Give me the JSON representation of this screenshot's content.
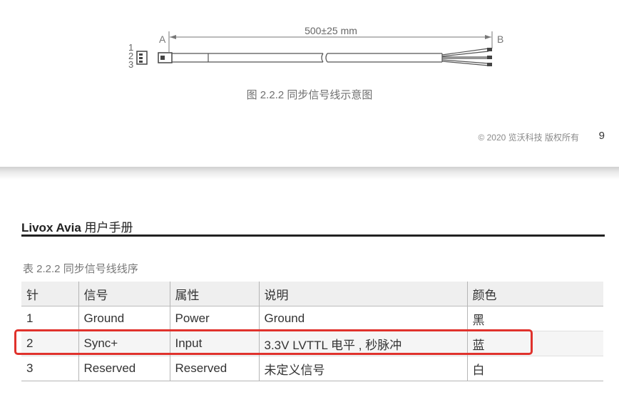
{
  "figure": {
    "end_a": "A",
    "end_b": "B",
    "length": "500±25 mm",
    "pins": [
      "1",
      "2",
      "3"
    ],
    "caption": "图 2.2.2 同步信号线示意图"
  },
  "footer": {
    "copyright": "© 2020 览沃科技 版权所有",
    "page_number": "9"
  },
  "header": {
    "product": "Livox Avia",
    "title": "用户手册"
  },
  "table": {
    "caption": "表 2.2.2 同步信号线线序",
    "columns": [
      "针",
      "信号",
      "属性",
      "说明",
      "颜色"
    ],
    "rows": [
      [
        "1",
        "Ground",
        "Power",
        "Ground",
        "黑"
      ],
      [
        "2",
        "Sync+",
        "Input",
        "3.3V LVTTL 电平 , 秒脉冲",
        "蓝"
      ],
      [
        "3",
        "Reserved",
        "Reserved",
        "未定义信号",
        "白"
      ]
    ],
    "highlighted_row": 2,
    "highlight_color": "#e0322c"
  }
}
